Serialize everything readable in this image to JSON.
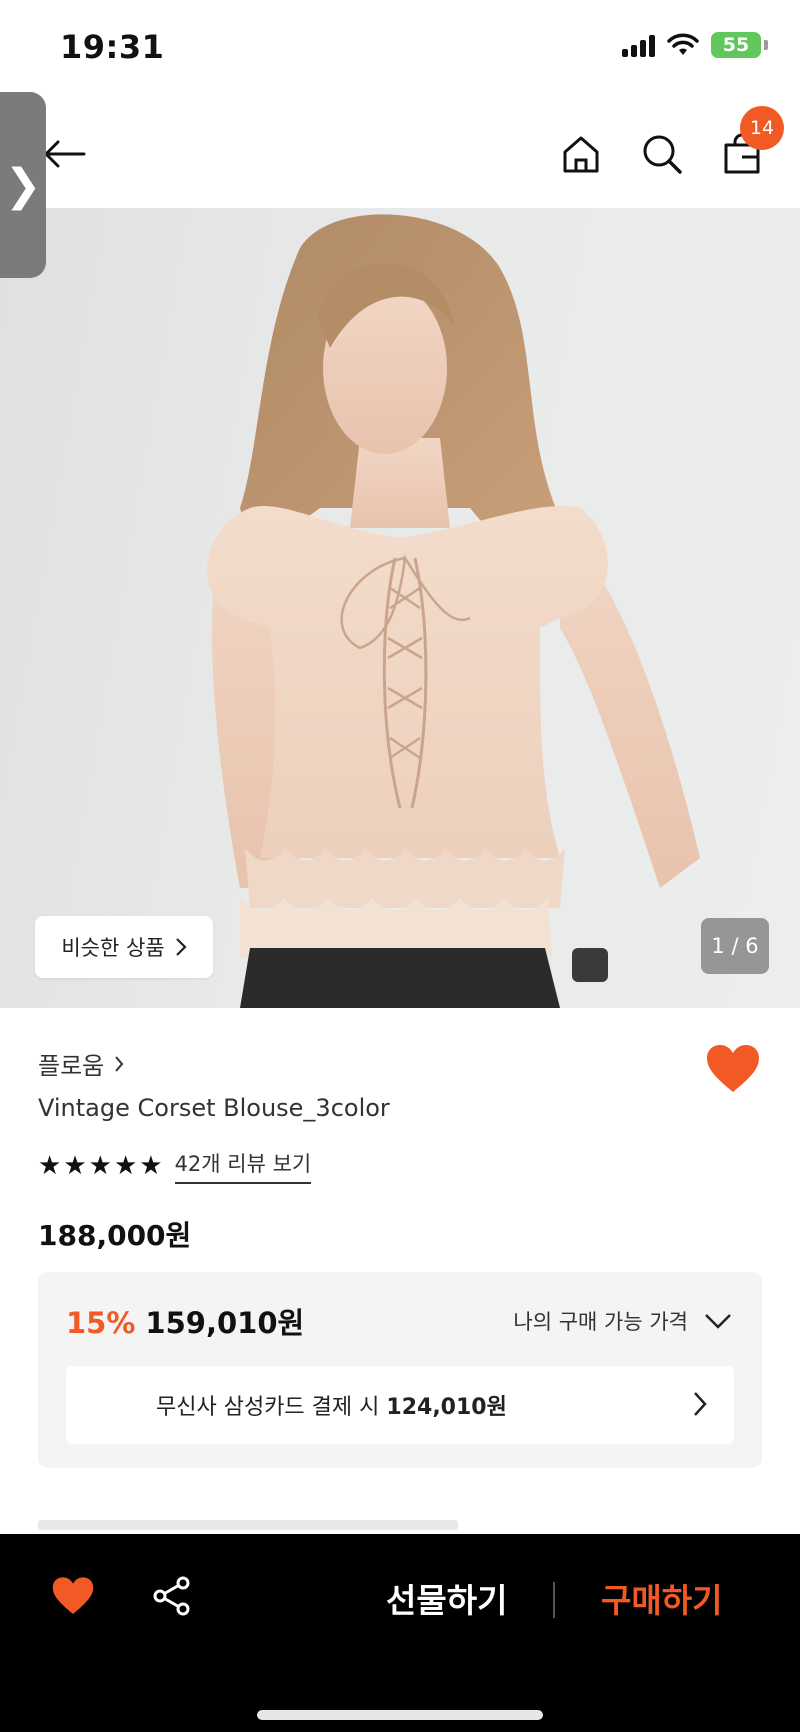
{
  "status_bar": {
    "time": "19:31",
    "battery": "55"
  },
  "header": {
    "cart_count": "14"
  },
  "side_handle": {
    "glyph": "❯"
  },
  "gallery": {
    "similar_label": "비슷한 상품",
    "pager": "1 / 6"
  },
  "product": {
    "brand": "플로움",
    "name": "Vintage Corset Blouse_3color",
    "rating": 5,
    "review_link": "42개 리뷰 보기",
    "original_price": "188,000원",
    "discount_rate": "15%",
    "sale_price": "159,010원",
    "my_price_label": "나의 구매 가능 가격",
    "card_offer_prefix": "무신사 삼성카드 결제 시",
    "card_offer_price": "124,010원"
  },
  "bottom_bar": {
    "gift_label": "선물하기",
    "buy_label": "구매하기"
  },
  "colors": {
    "accent": "#f15a24",
    "price_box_bg": "#f4f4f4",
    "bottom_bar_bg": "#000000"
  },
  "icons": [
    "back-arrow-icon",
    "home-icon",
    "search-icon",
    "shopping-bag-icon",
    "heart-icon",
    "share-icon",
    "chevron-right-icon",
    "chevron-down-icon"
  ]
}
